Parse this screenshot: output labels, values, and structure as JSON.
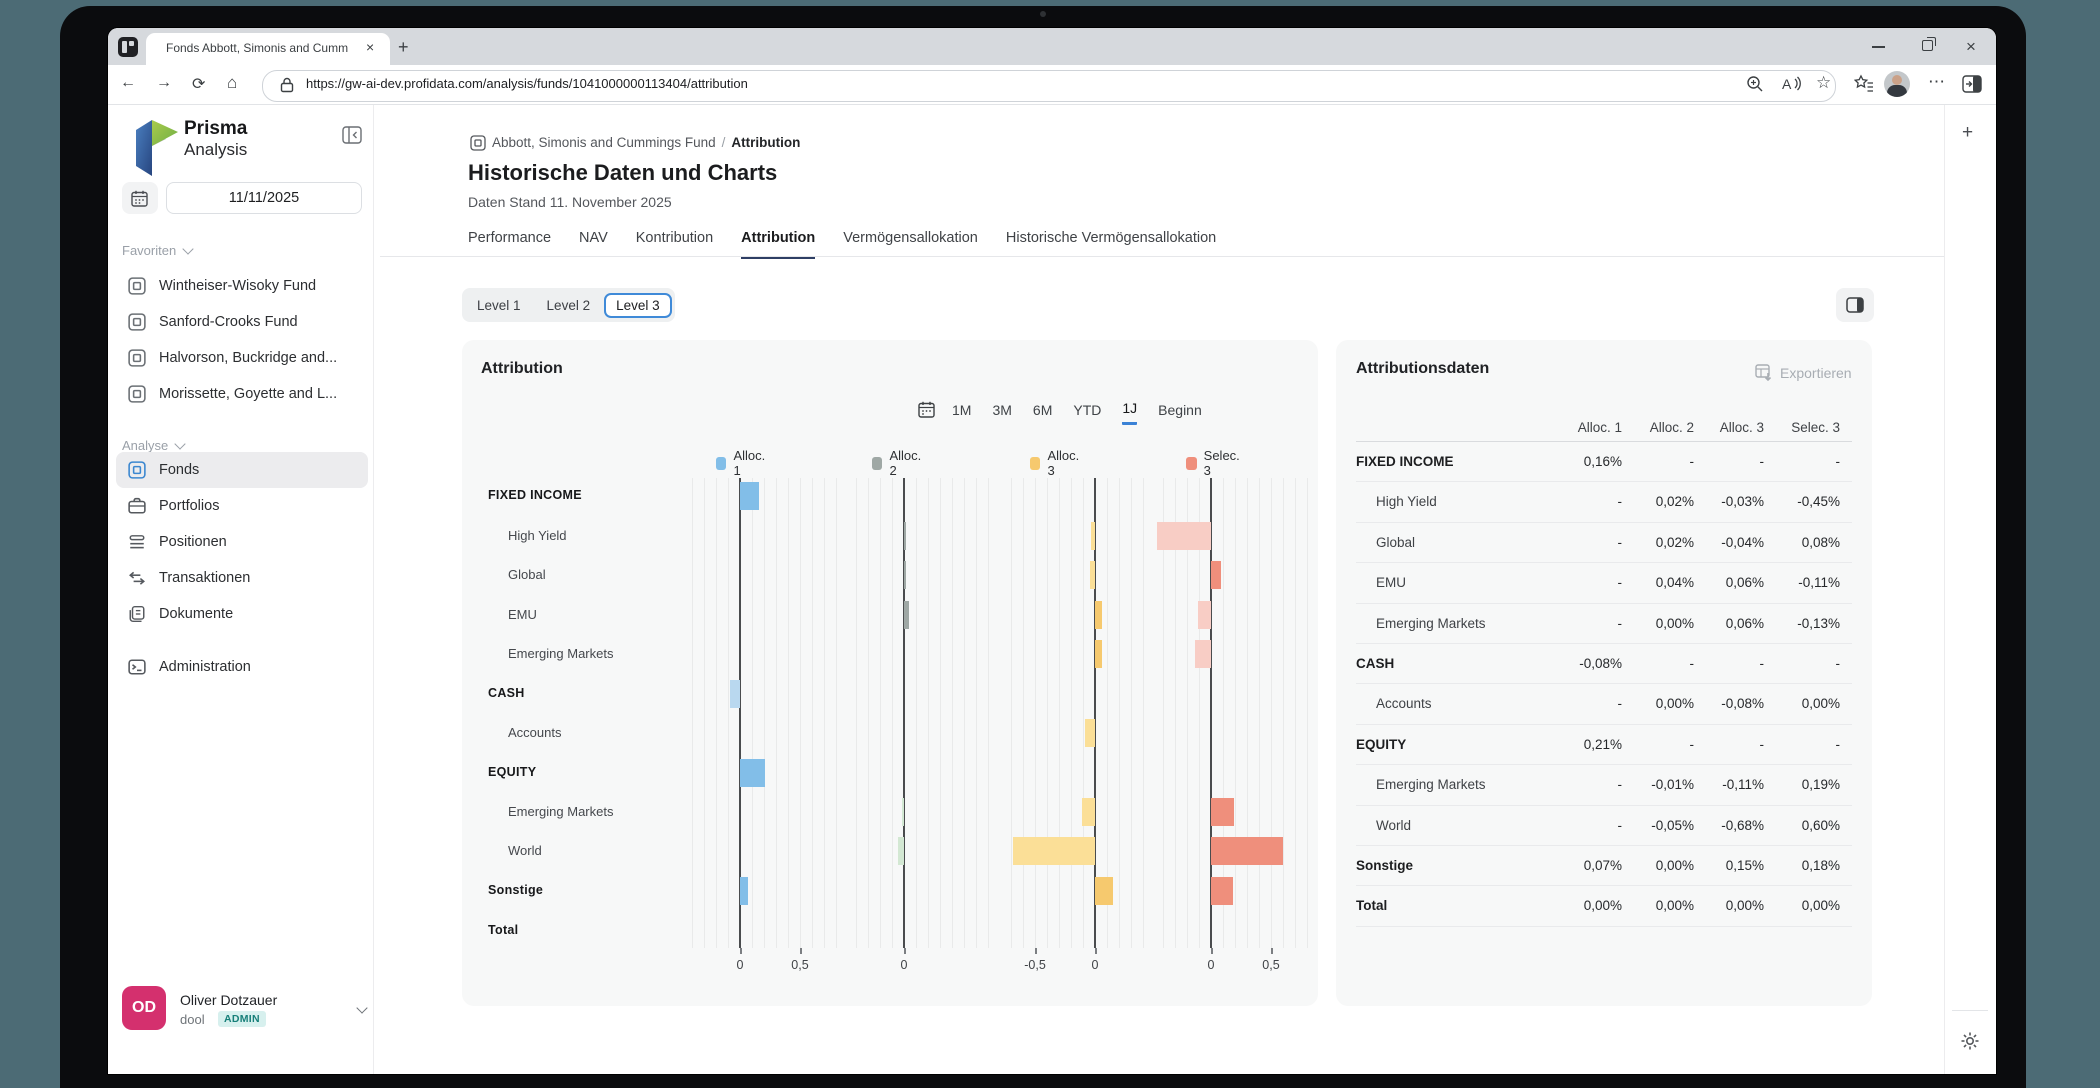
{
  "browser": {
    "tab_title": "Fonds Abbott, Simonis and Cumm",
    "url": "https://gw-ai-dev.profidata.com/analysis/funds/1041000000113404/attribution"
  },
  "icons": {
    "back": "←",
    "forward": "→",
    "refresh": "⟳",
    "home": "⌂",
    "star": "☆",
    "dots": "⋯",
    "close": "×",
    "plus": "+",
    "transactions": "⇆"
  },
  "sidebar": {
    "logo_line1": "Prisma",
    "logo_line2": "Analysis",
    "date_value": "11/11/2025",
    "favorites_header": "Favoriten",
    "favorites": [
      {
        "label": "Wintheiser-Wisoky Fund",
        "icon": "fund-icon"
      },
      {
        "label": "Sanford-Crooks Fund",
        "icon": "fund-icon"
      },
      {
        "label": "Halvorson, Buckridge and...",
        "icon": "fund-icon"
      },
      {
        "label": "Morissette, Goyette and L...",
        "icon": "fund-icon"
      }
    ],
    "analyse_header": "Analyse",
    "menu": [
      {
        "label": "Fonds",
        "icon": "fund-icon",
        "active": true
      },
      {
        "label": "Portfolios",
        "icon": "briefcase-icon",
        "active": false
      },
      {
        "label": "Positionen",
        "icon": "positions-icon",
        "active": false
      },
      {
        "label": "Transaktionen",
        "icon": "transactions-icon",
        "active": false
      },
      {
        "label": "Dokumente",
        "icon": "documents-icon",
        "active": false
      }
    ],
    "admin_item": {
      "label": "Administration",
      "icon": "admin-icon"
    },
    "user": {
      "initials": "OD",
      "name": "Oliver Dotzauer",
      "username": "dool",
      "role_badge": "ADMIN"
    }
  },
  "header": {
    "breadcrumb_fund": "Abbott, Simonis and Cummings Fund",
    "breadcrumb_sep": "/",
    "breadcrumb_page": "Attribution",
    "title": "Historische Daten und Charts",
    "subtitle": "Daten Stand 11. November 2025",
    "tabs": [
      "Performance",
      "NAV",
      "Kontribution",
      "Attribution",
      "Vermögensallokation",
      "Historische Vermögensallokation"
    ],
    "active_tab": "Attribution"
  },
  "levels": {
    "options": [
      "Level 1",
      "Level 2",
      "Level 3"
    ],
    "selected": "Level 3"
  },
  "chart_panel": {
    "title": "Attribution",
    "ranges": [
      "1M",
      "3M",
      "6M",
      "YTD",
      "1J",
      "Beginn"
    ],
    "active_range": "1J"
  },
  "table_panel": {
    "title": "Attributionsdaten",
    "export_label": "Exportieren",
    "columns": [
      "Alloc. 1",
      "Alloc. 2",
      "Alloc. 3",
      "Selec. 3"
    ],
    "rows": [
      {
        "label": "FIXED INCOME",
        "group": true,
        "values": [
          "0,16%",
          "-",
          "-",
          "-"
        ]
      },
      {
        "label": "High Yield",
        "group": false,
        "values": [
          "-",
          "0,02%",
          "-0,03%",
          "-0,45%"
        ]
      },
      {
        "label": "Global",
        "group": false,
        "values": [
          "-",
          "0,02%",
          "-0,04%",
          "0,08%"
        ]
      },
      {
        "label": "EMU",
        "group": false,
        "values": [
          "-",
          "0,04%",
          "0,06%",
          "-0,11%"
        ]
      },
      {
        "label": "Emerging Markets",
        "group": false,
        "values": [
          "-",
          "0,00%",
          "0,06%",
          "-0,13%"
        ]
      },
      {
        "label": "CASH",
        "group": true,
        "values": [
          "-0,08%",
          "-",
          "-",
          "-"
        ]
      },
      {
        "label": "Accounts",
        "group": false,
        "values": [
          "-",
          "0,00%",
          "-0,08%",
          "0,00%"
        ]
      },
      {
        "label": "EQUITY",
        "group": true,
        "values": [
          "0,21%",
          "-",
          "-",
          "-"
        ]
      },
      {
        "label": "Emerging Markets",
        "group": false,
        "values": [
          "-",
          "-0,01%",
          "-0,11%",
          "0,19%"
        ]
      },
      {
        "label": "World",
        "group": false,
        "values": [
          "-",
          "-0,05%",
          "-0,68%",
          "0,60%"
        ]
      },
      {
        "label": "Sonstige",
        "group": true,
        "values": [
          "0,07%",
          "0,00%",
          "0,15%",
          "0,18%"
        ]
      },
      {
        "label": "Total",
        "group": true,
        "values": [
          "0,00%",
          "0,00%",
          "0,00%",
          "0,00%"
        ]
      }
    ]
  },
  "chart_data": {
    "type": "bar",
    "orientation": "horizontal",
    "title": "Attribution",
    "unit": "%",
    "categories": [
      {
        "label": "FIXED INCOME",
        "group": true
      },
      {
        "label": "High Yield",
        "group": false
      },
      {
        "label": "Global",
        "group": false
      },
      {
        "label": "EMU",
        "group": false
      },
      {
        "label": "Emerging Markets",
        "group": false
      },
      {
        "label": "CASH",
        "group": true
      },
      {
        "label": "Accounts",
        "group": false
      },
      {
        "label": "EQUITY",
        "group": true
      },
      {
        "label": "Emerging Markets",
        "group": false
      },
      {
        "label": "World",
        "group": false
      },
      {
        "label": "Sonstige",
        "group": true
      },
      {
        "label": "Total",
        "group": true
      }
    ],
    "series": [
      {
        "name": "Alloc. 1",
        "color": "#82bee8",
        "color_negative": "#b9d8ef",
        "values": [
          0.16,
          null,
          null,
          null,
          null,
          -0.08,
          null,
          0.21,
          null,
          null,
          0.07,
          0.0
        ],
        "axis_ticks": [
          0,
          0.5
        ]
      },
      {
        "name": "Alloc. 2",
        "color": "#9fa8a5",
        "color_negative": "#d3e8d3",
        "values": [
          null,
          0.02,
          0.02,
          0.04,
          0.0,
          null,
          0.0,
          null,
          -0.01,
          -0.05,
          0.0,
          0.0
        ],
        "axis_ticks": [
          0
        ]
      },
      {
        "name": "Alloc. 3",
        "color": "#f6c96e",
        "color_negative": "#fbdf97",
        "values": [
          null,
          -0.03,
          -0.04,
          0.06,
          0.06,
          null,
          -0.08,
          null,
          -0.11,
          -0.68,
          0.15,
          0.0
        ],
        "axis_ticks": [
          -0.5,
          0
        ]
      },
      {
        "name": "Selec. 3",
        "color": "#ef8f7c",
        "color_negative": "#f8cdc5",
        "values": [
          null,
          -0.45,
          0.08,
          -0.11,
          -0.13,
          null,
          0.0,
          null,
          0.19,
          0.6,
          0.18,
          0.0
        ],
        "axis_ticks": [
          0,
          0.5
        ]
      }
    ],
    "legend_position": "top",
    "grid": true
  }
}
